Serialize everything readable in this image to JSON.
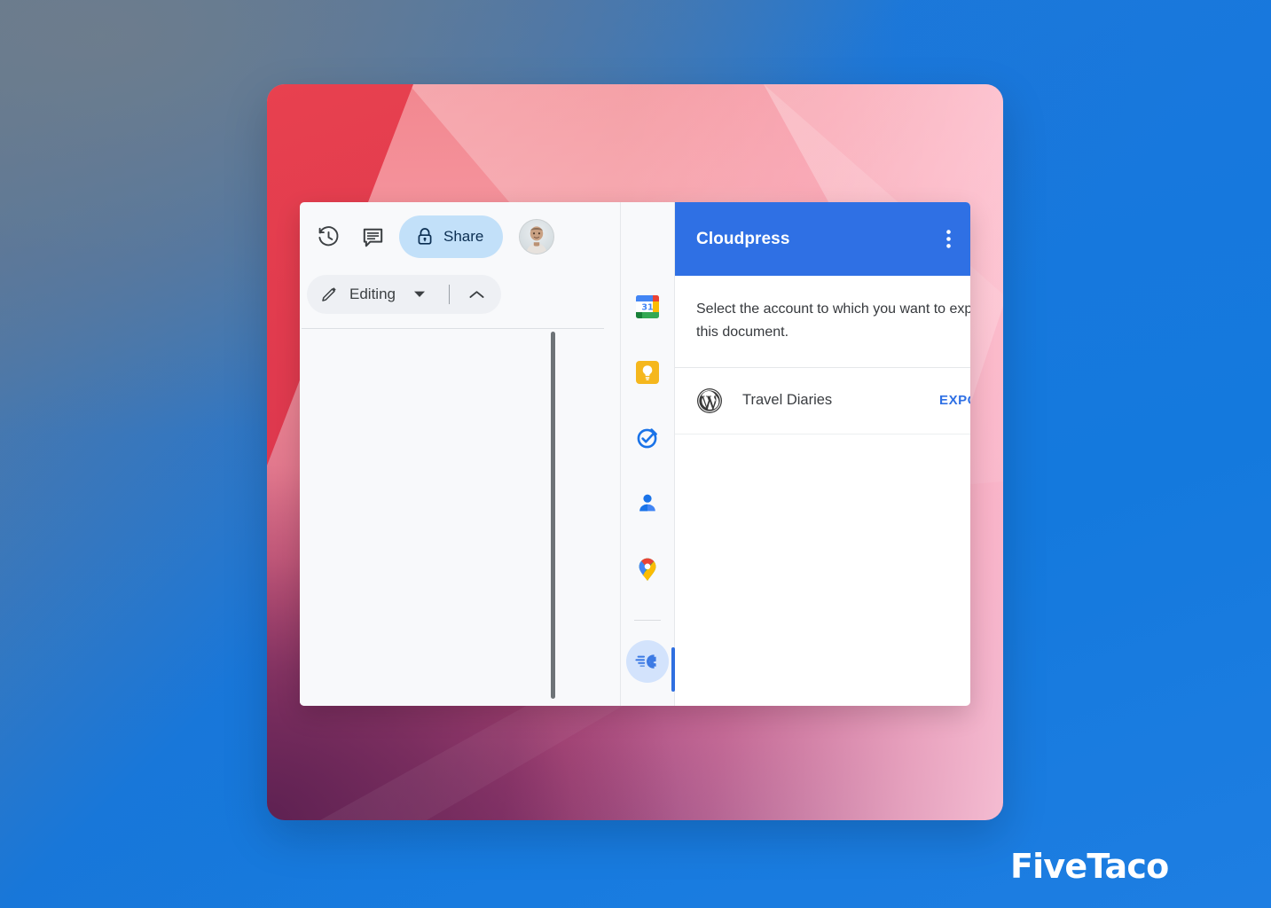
{
  "brand": {
    "logo_text": "FiveTaco"
  },
  "docs": {
    "toolbar": {
      "history_icon": "version-history-icon",
      "comment_icon": "comment-icon",
      "share_label": "Share",
      "share_lock_icon": "lock-icon",
      "avatar_icon": "user-avatar"
    },
    "mode": {
      "pencil_icon": "pencil-icon",
      "label": "Editing",
      "caret_down_icon": "chevron-down-icon",
      "caret_up_icon": "chevron-up-icon"
    }
  },
  "rail": {
    "items": [
      {
        "name": "google-calendar",
        "label": "Calendar",
        "badge": "31"
      },
      {
        "name": "google-keep",
        "label": "Keep"
      },
      {
        "name": "google-tasks",
        "label": "Tasks"
      },
      {
        "name": "google-contacts",
        "label": "Contacts"
      },
      {
        "name": "google-maps",
        "label": "Maps"
      },
      {
        "name": "cloudpress-addon",
        "label": "Cloudpress"
      }
    ]
  },
  "addon": {
    "title": "Cloudpress",
    "more_icon": "more-vertical-icon",
    "close_icon": "close-icon",
    "instruction": "Select the account to which you want to export this document.",
    "accounts": [
      {
        "logo_icon": "wordpress-icon",
        "name": "Travel Diaries",
        "action_label": "EXPORT"
      }
    ]
  },
  "colors": {
    "addon_header_blue": "#2F70E4",
    "export_link_blue": "#2F70E4",
    "share_button_bg": "#C2E0F9",
    "active_rail_bar": "#2F6FE0",
    "page_background_blue": "#1878DD"
  }
}
